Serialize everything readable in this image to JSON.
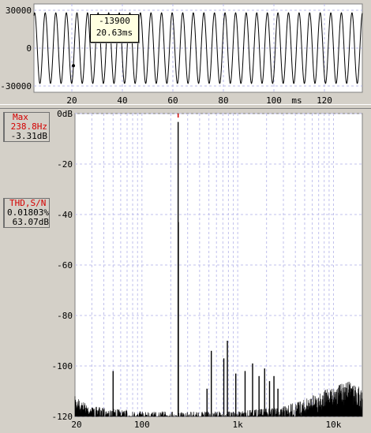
{
  "waveform": {
    "y_ticks": [
      "30000",
      "0",
      "-30000"
    ],
    "x_ticks": [
      "20",
      "40",
      "60",
      "80",
      "100",
      "120"
    ],
    "x_unit": "ms",
    "tooltip": {
      "value": "-13900",
      "time": "20.63ms"
    }
  },
  "side_panel": {
    "max_label": "Max",
    "max_freq": "238.8Hz",
    "max_db": "-3.31dB",
    "thd_label": "THD,S/N",
    "thd_value": "0.01803%",
    "sn_value": "63.07dB"
  },
  "chart_data": [
    {
      "type": "line",
      "xlabel": "ms",
      "ylabel": "",
      "xlim": [
        5,
        135
      ],
      "ylim": [
        -35000,
        35000
      ],
      "x_ticks": [
        20,
        40,
        60,
        80,
        100,
        120
      ],
      "y_ticks": [
        30000,
        0,
        -30000
      ],
      "series": [
        {
          "signal": "sine",
          "frequency_hz": 238.8,
          "amplitude": 28000
        }
      ],
      "cursor": {
        "x": 20.63,
        "y": -13900
      },
      "grid": true
    },
    {
      "type": "line",
      "xscale": "log",
      "xlim": [
        20,
        20000
      ],
      "ylim": [
        -120,
        0
      ],
      "x_ticks": [
        "20",
        "100",
        "1k",
        "10k"
      ],
      "y_ticks": [
        "0dB",
        "-20",
        "-40",
        "-60",
        "-80",
        "-100",
        "-120"
      ],
      "grid": true,
      "peaks": [
        {
          "freq": 50,
          "db": -102
        },
        {
          "freq": 238.8,
          "db": -3.31
        },
        {
          "freq": 240,
          "db": -43
        },
        {
          "freq": 478,
          "db": -109
        },
        {
          "freq": 530,
          "db": -94
        },
        {
          "freq": 716,
          "db": -97
        },
        {
          "freq": 780,
          "db": -90
        },
        {
          "freq": 955,
          "db": -103
        },
        {
          "freq": 1194,
          "db": -102
        },
        {
          "freq": 1430,
          "db": -99
        },
        {
          "freq": 1670,
          "db": -104
        },
        {
          "freq": 1910,
          "db": -101
        },
        {
          "freq": 2150,
          "db": -106
        },
        {
          "freq": 2390,
          "db": -104
        },
        {
          "freq": 2630,
          "db": -109
        }
      ],
      "noise_floor": [
        {
          "freq": 20,
          "db": -112
        },
        {
          "freq": 30,
          "db": -116
        },
        {
          "freq": 100,
          "db": -118
        },
        {
          "freq": 1000,
          "db": -118
        },
        {
          "freq": 3000,
          "db": -116
        },
        {
          "freq": 5000,
          "db": -113
        },
        {
          "freq": 10000,
          "db": -108
        },
        {
          "freq": 15000,
          "db": -106
        },
        {
          "freq": 20000,
          "db": -109
        }
      ]
    }
  ]
}
